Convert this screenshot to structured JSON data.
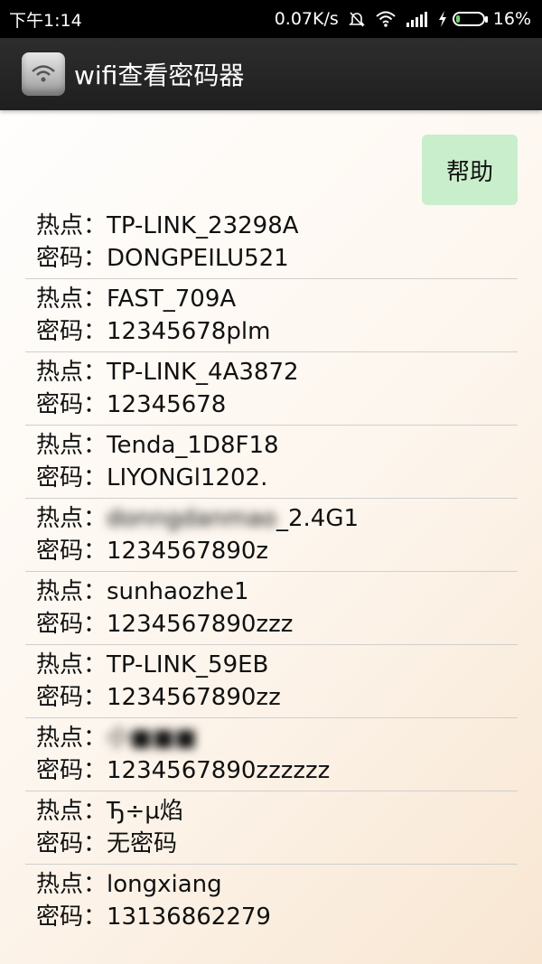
{
  "status_bar": {
    "time": "下午1:14",
    "speed": "0.07K/s",
    "battery": "16%",
    "battery_level": 0.16,
    "icons": [
      "mute-icon",
      "wifi-signal-icon",
      "cell-signal-icon",
      "charging-icon",
      "battery-icon"
    ]
  },
  "app_bar": {
    "title": "wifi查看密码器",
    "icon": "wifi-drive-icon"
  },
  "help_button": {
    "label": "帮助",
    "color": "#c9eecb"
  },
  "labels": {
    "hotspot": "热点：",
    "password": "密码："
  },
  "wifi_list": [
    {
      "ssid": "TP-LINK_23298A",
      "password": "DONGPEILU521",
      "ssid_blurred_prefix": "",
      "password_blurred": false
    },
    {
      "ssid": "FAST_709A",
      "password": "12345678plm",
      "ssid_blurred_prefix": "",
      "password_blurred": false
    },
    {
      "ssid": "TP-LINK_4A3872",
      "password": "12345678",
      "ssid_blurred_prefix": "",
      "password_blurred": false
    },
    {
      "ssid": "Tenda_1D8F18",
      "password": "LIYONGl1202.",
      "ssid_blurred_prefix": "",
      "password_blurred": false
    },
    {
      "ssid": "_2.4G1",
      "password": "1234567890z",
      "ssid_blurred_prefix": "donngdanmao",
      "password_blurred": false
    },
    {
      "ssid": "sunhaozhe1",
      "password": "1234567890zzz",
      "ssid_blurred_prefix": "",
      "password_blurred": false
    },
    {
      "ssid": "TP-LINK_59EB",
      "password": "1234567890zz",
      "ssid_blurred_prefix": "",
      "password_blurred": false
    },
    {
      "ssid": "",
      "password": "1234567890zzzzzz",
      "ssid_blurred_prefix": "小■■■",
      "password_blurred": false
    },
    {
      "ssid": "Ђ÷µ焰",
      "password": "无密码",
      "ssid_blurred_prefix": "",
      "password_blurred": false
    },
    {
      "ssid": "longxiang",
      "password": "13136862279",
      "ssid_blurred_prefix": "",
      "password_blurred": false
    }
  ]
}
